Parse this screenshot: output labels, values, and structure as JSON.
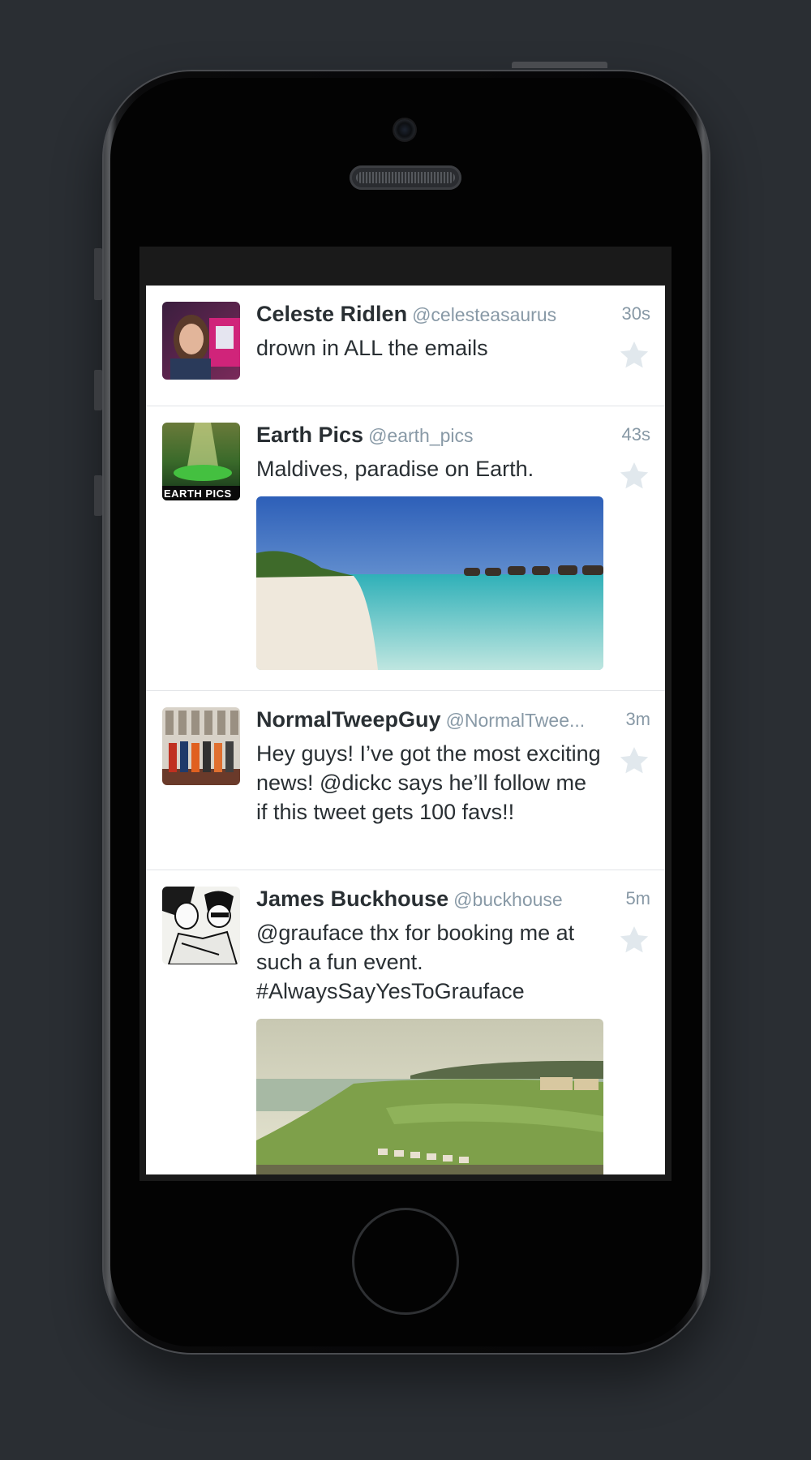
{
  "tweets": [
    {
      "name": "Celeste Ridlen",
      "handle": "@celesteasaurus",
      "time": "30s",
      "text": "drown in ALL the emails"
    },
    {
      "name": "Earth Pics",
      "handle": "@earth_pics",
      "time": "43s",
      "text": "Maldives, paradise on Earth.",
      "avatar_text": "EARTH PICS"
    },
    {
      "name": "NormalTweepGuy",
      "handle": "@NormalTwee...",
      "time": "3m",
      "text": "Hey guys! I’ve got the most exciting news! @dickc says he’ll follow me if this tweet gets 100 favs!!"
    },
    {
      "name": "James Buckhouse",
      "handle": "@buckhouse",
      "time": "5m",
      "text": "@grauface thx for booking me at such a fun event. #AlwaysSayYesToGrauface"
    }
  ],
  "icons": {
    "favorite": "star-icon"
  },
  "colors": {
    "name": "#292f33",
    "meta": "#8899a6",
    "star": "#e1e8ed",
    "background": "#2a2e33"
  }
}
